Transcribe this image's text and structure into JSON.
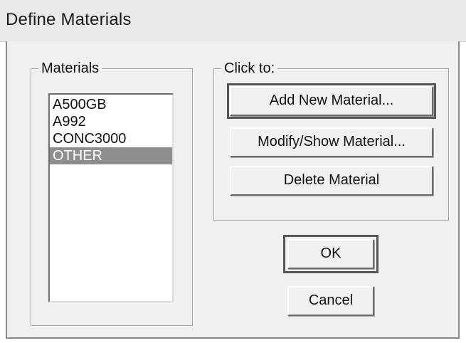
{
  "window": {
    "title": "Define Materials"
  },
  "materials": {
    "legend": "Materials",
    "items": [
      {
        "label": "A500GB",
        "selected": false
      },
      {
        "label": "A992",
        "selected": false
      },
      {
        "label": "CONC3000",
        "selected": false
      },
      {
        "label": "OTHER",
        "selected": true
      }
    ]
  },
  "actions": {
    "legend": "Click to:",
    "add_label": "Add New Material...",
    "modify_label": "Modify/Show Material...",
    "delete_label": "Delete Material"
  },
  "dialog_buttons": {
    "ok_label": "OK",
    "cancel_label": "Cancel"
  },
  "colors": {
    "selection_background": "#8e8e8e",
    "dialog_background": "#f0f0f0"
  }
}
